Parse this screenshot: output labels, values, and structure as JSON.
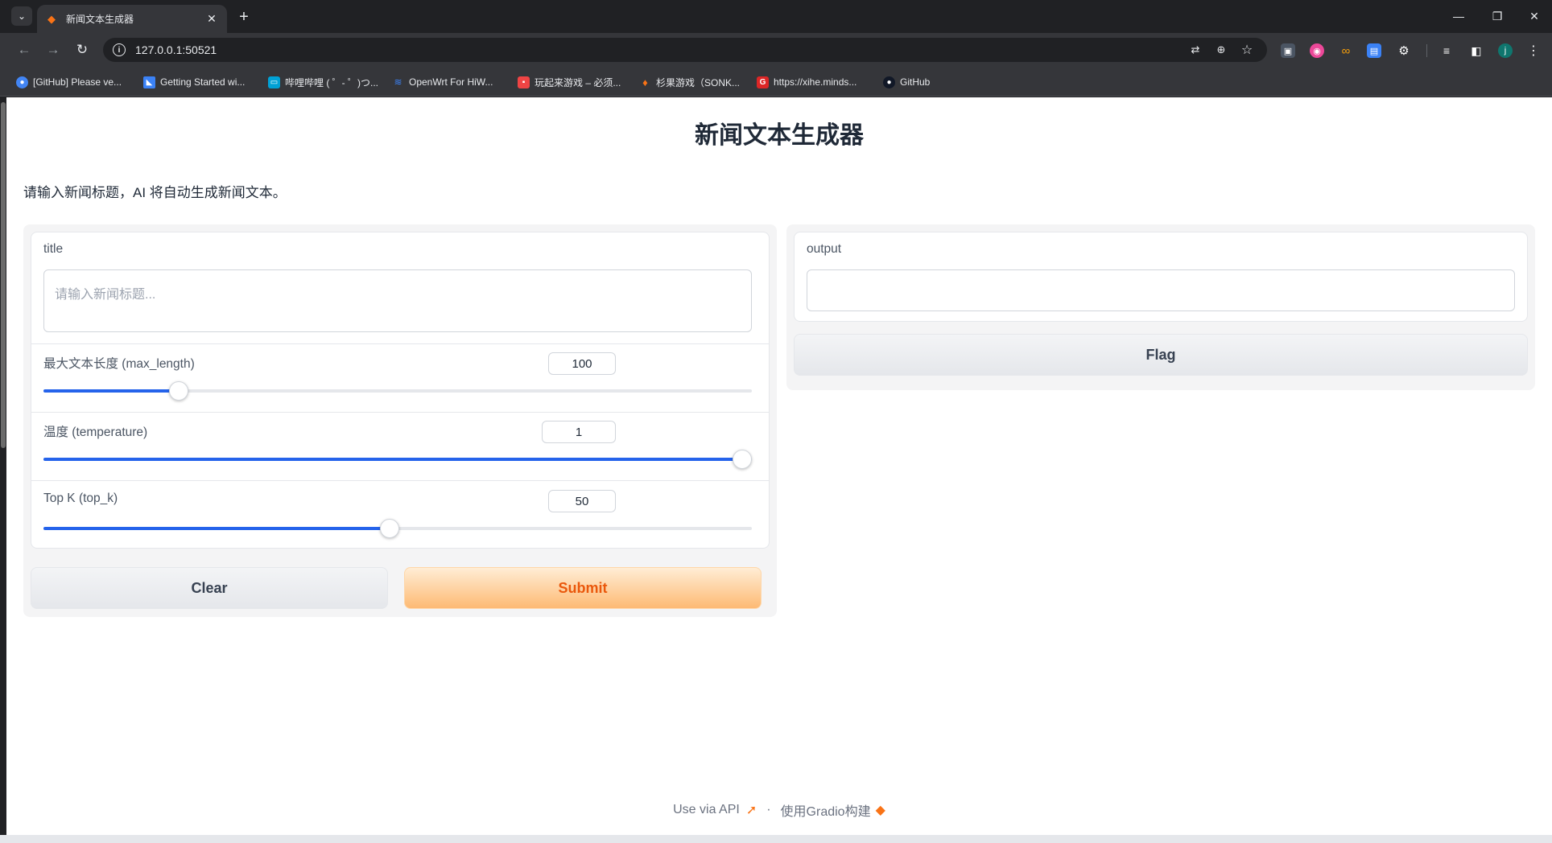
{
  "browser": {
    "tab_title": "新闻文本生成器",
    "tab_close": "✕",
    "new_tab": "+",
    "url": "127.0.0.1:50521",
    "bookmarks": [
      {
        "label": "[GitHub] Please ve...",
        "icon": "chrome-icon",
        "color": "#4285f4"
      },
      {
        "label": "Getting Started wi...",
        "icon": "bookmark-icon",
        "color": "#3b82f6"
      },
      {
        "label": "哔哩哔哩 ( ゜- ゜)つ...",
        "icon": "bilibili-icon",
        "color": "#00a1d6"
      },
      {
        "label": "OpenWrt For HiW...",
        "icon": "wifi-icon",
        "color": "#3b82f6"
      },
      {
        "label": "玩起来游戏 – 必须...",
        "icon": "game-icon",
        "color": "#ef4444"
      },
      {
        "label": "杉果游戏（SONK...",
        "icon": "sonkwo-icon",
        "color": "#f97316"
      },
      {
        "label": "https://xihe.minds...",
        "icon": "g-icon",
        "color": "#dc2626"
      },
      {
        "label": "GitHub",
        "icon": "github-icon",
        "color": "#111827"
      }
    ]
  },
  "app": {
    "title": "新闻文本生成器",
    "description": "请输入新闻标题，AI 将自动生成新闻文本。",
    "inputs": {
      "title_label": "title",
      "title_placeholder": "请输入新闻标题...",
      "max_length": {
        "label": "最大文本长度 (max_length)",
        "value": "100",
        "fraction": 0.193
      },
      "temperature": {
        "label": "温度 (temperature)",
        "value": "1",
        "fraction": 1.0
      },
      "top_k": {
        "label": "Top K (top_k)",
        "value": "50",
        "fraction": 0.495
      }
    },
    "clear_label": "Clear",
    "submit_label": "Submit",
    "output_label": "output",
    "flag_label": "Flag",
    "footer": {
      "api_label": "Use via API",
      "separator": "·",
      "built_with": "使用Gradio构建"
    },
    "colors": {
      "accent": "#2563eb",
      "primary": "#ea580c"
    }
  }
}
